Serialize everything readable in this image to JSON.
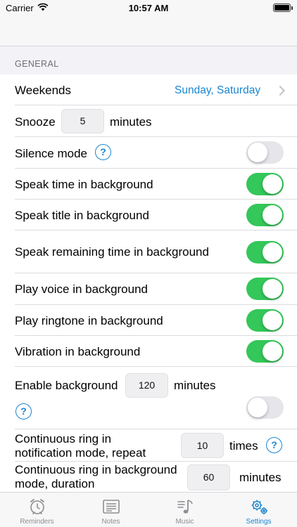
{
  "status_bar": {
    "carrier": "Carrier",
    "time": "10:57 AM"
  },
  "section": {
    "title": "GENERAL"
  },
  "rows": {
    "weekends": {
      "label": "Weekends",
      "value": "Sunday, Saturday"
    },
    "snooze": {
      "label": "Snooze",
      "value": "5",
      "unit": "minutes"
    },
    "silence_mode": {
      "label": "Silence mode",
      "help": "?",
      "on": false
    },
    "speak_time": {
      "label": "Speak time in background",
      "on": true
    },
    "speak_title": {
      "label": "Speak title in background",
      "on": true
    },
    "speak_remaining": {
      "label": "Speak remaining time in background",
      "on": true
    },
    "play_voice": {
      "label": "Play voice in background",
      "on": true
    },
    "play_ringtone": {
      "label": "Play ringtone in background",
      "on": true
    },
    "vibration": {
      "label": "Vibration in background",
      "on": true
    },
    "enable_background": {
      "label": "Enable background",
      "value": "120",
      "unit": "minutes",
      "help": "?",
      "on": false
    },
    "continuous_ring_notification": {
      "label_line1": "Continuous ring in",
      "label_line2": "notification mode, repeat",
      "value": "10",
      "unit": "times",
      "help": "?"
    },
    "continuous_ring_background": {
      "label_line1": "Continuous ring in background",
      "label_line2": "mode, duration",
      "value": "60",
      "unit": "minutes"
    }
  },
  "tabs": [
    {
      "label": "Reminders",
      "icon": "clock-icon",
      "active": false
    },
    {
      "label": "Notes",
      "icon": "notes-icon",
      "active": false
    },
    {
      "label": "Music",
      "icon": "music-icon",
      "active": false
    },
    {
      "label": "Settings",
      "icon": "gear-icon",
      "active": true
    }
  ],
  "colors": {
    "accent": "#1a86d0",
    "toggle_on": "#34c759",
    "toggle_off": "#e6e6ea",
    "background": "#f2f2f7"
  }
}
